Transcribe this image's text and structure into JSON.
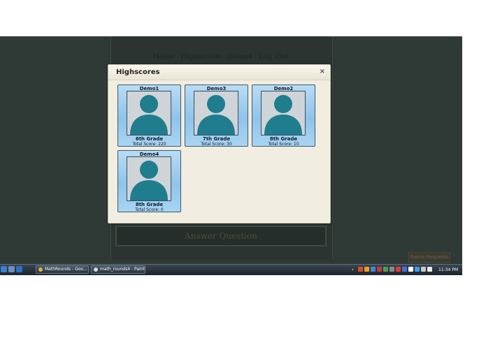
{
  "app": {
    "nav": [
      "Home",
      "Highscores",
      "Demo4",
      "Log Out"
    ],
    "answer_button": "Answer Question",
    "game_requests_button": "Game Requests"
  },
  "modal": {
    "title": "Highscores",
    "close": "×",
    "cards": [
      {
        "name": "Demo1",
        "grade": "6th Grade",
        "score": "Total Score: 220"
      },
      {
        "name": "Demo3",
        "grade": "7th Grade",
        "score": "Total Score: 30"
      },
      {
        "name": "Demo2",
        "grade": "8th Grade",
        "score": "Total Score: 10"
      },
      {
        "name": "Demo4",
        "grade": "8th Grade",
        "score": "Total Score: 0"
      }
    ]
  },
  "taskbar": {
    "windows": [
      {
        "label": "MathRounds - Goo..."
      },
      {
        "label": "math_rounds4 - Paint"
      }
    ],
    "clock": "11:34 PM"
  },
  "colors": {
    "backdrop": "#2f3a36",
    "modal_bg": "#f1ede0",
    "card_blue": "#8fc3ea",
    "avatar_teal": "#1f7d8e"
  }
}
